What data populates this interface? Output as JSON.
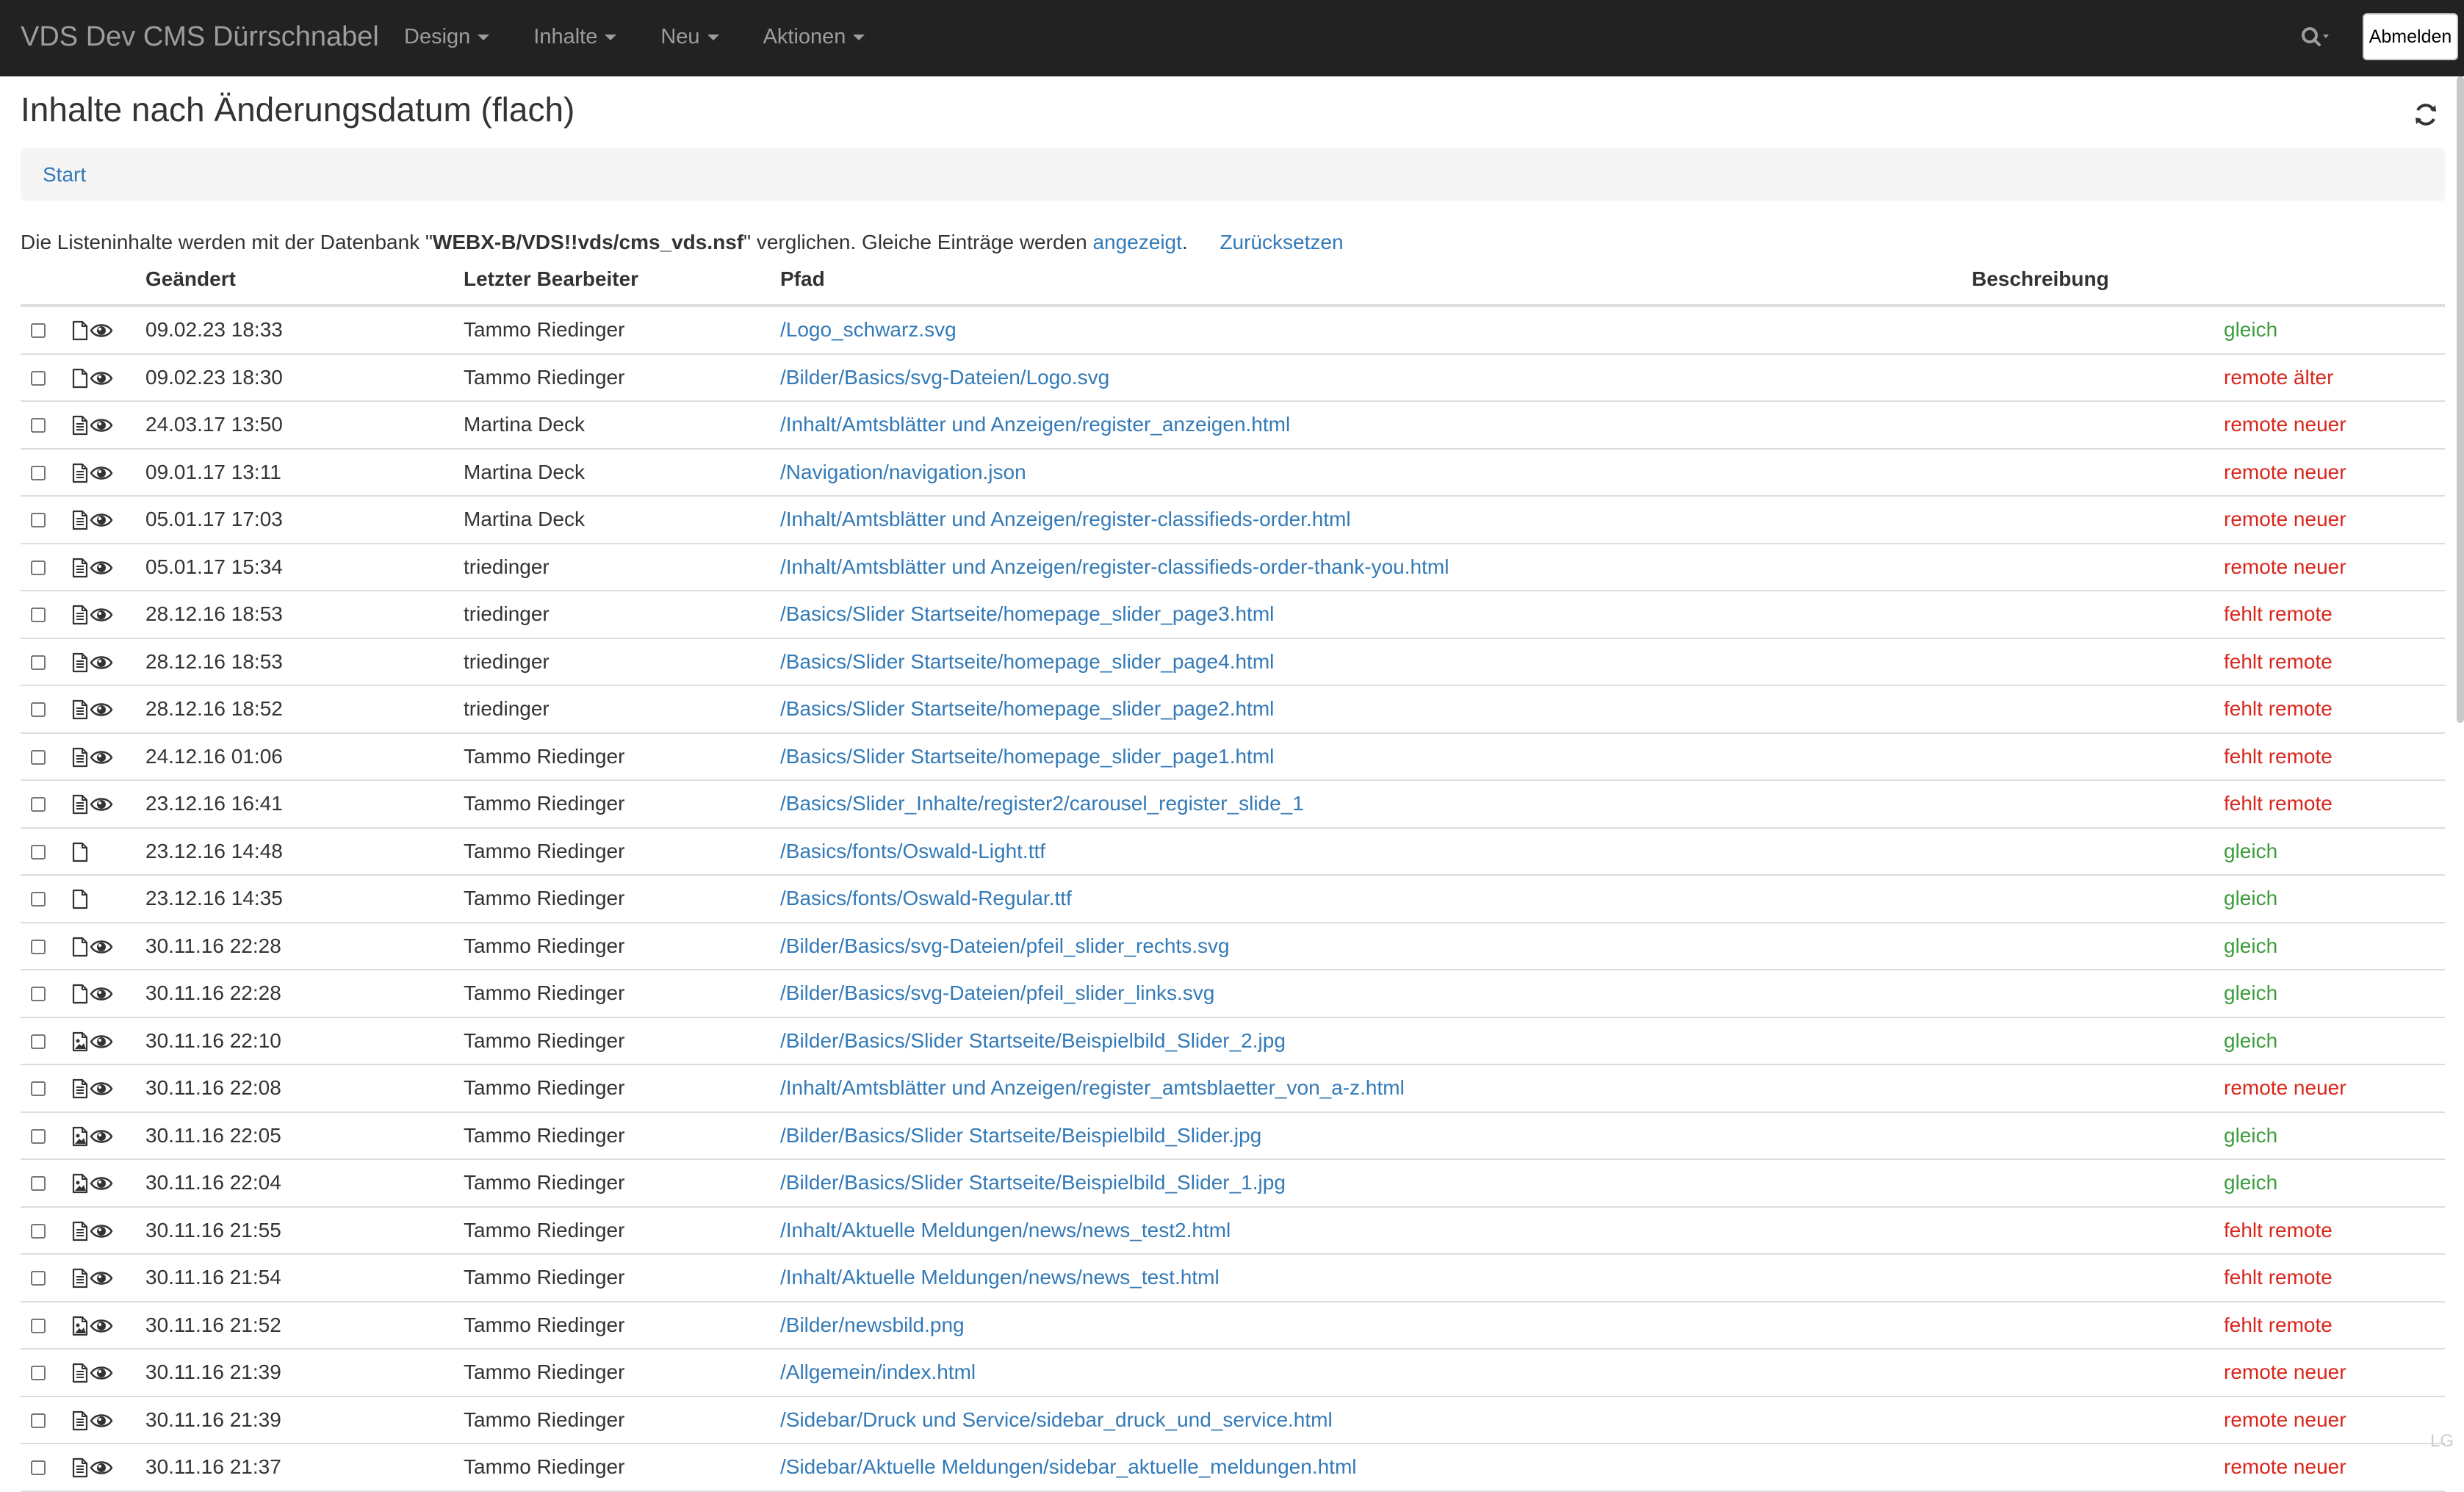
{
  "navbar": {
    "brand": "VDS Dev CMS Dürrschnabel",
    "menu": [
      "Design",
      "Inhalte",
      "Neu",
      "Aktionen"
    ],
    "logout_label": "Abmelden"
  },
  "page": {
    "title": "Inhalte nach Änderungsdatum (flach)",
    "breadcrumb": "Start"
  },
  "info": {
    "prefix": "Die Listeninhalte werden mit der Datenbank \"",
    "database": "WEBX-B/VDS!!vds/cms_vds.nsf",
    "middle": "\" verglichen. Gleiche Einträge werden ",
    "link_shown": "angezeigt",
    "dot": ".",
    "link_reset": "Zurücksetzen"
  },
  "table": {
    "headers": {
      "changed": "Geändert",
      "editor": "Letzter Bearbeiter",
      "path": "Pfad",
      "description": "Beschreibung"
    },
    "rows": [
      {
        "icon": "file",
        "preview": true,
        "date": "09.02.23 18:33",
        "editor": "Tammo Riedinger",
        "path": "/Logo_schwarz.svg",
        "status": "gleich",
        "status_type": "same"
      },
      {
        "icon": "file",
        "preview": true,
        "date": "09.02.23 18:30",
        "editor": "Tammo Riedinger",
        "path": "/Bilder/Basics/svg-Dateien/Logo.svg",
        "status": "remote älter",
        "status_type": "diff"
      },
      {
        "icon": "doc",
        "preview": true,
        "date": "24.03.17 13:50",
        "editor": "Martina Deck",
        "path": "/Inhalt/Amtsblätter und Anzeigen/register_anzeigen.html",
        "status": "remote neuer",
        "status_type": "diff"
      },
      {
        "icon": "doc",
        "preview": true,
        "date": "09.01.17 13:11",
        "editor": "Martina Deck",
        "path": "/Navigation/navigation.json",
        "status": "remote neuer",
        "status_type": "diff"
      },
      {
        "icon": "doc",
        "preview": true,
        "date": "05.01.17 17:03",
        "editor": "Martina Deck",
        "path": "/Inhalt/Amtsblätter und Anzeigen/register-classifieds-order.html",
        "status": "remote neuer",
        "status_type": "diff"
      },
      {
        "icon": "doc",
        "preview": true,
        "date": "05.01.17 15:34",
        "editor": "triedinger",
        "path": "/Inhalt/Amtsblätter und Anzeigen/register-classifieds-order-thank-you.html",
        "status": "remote neuer",
        "status_type": "diff"
      },
      {
        "icon": "doc",
        "preview": true,
        "date": "28.12.16 18:53",
        "editor": "triedinger",
        "path": "/Basics/Slider Startseite/homepage_slider_page3.html",
        "status": "fehlt remote",
        "status_type": "diff"
      },
      {
        "icon": "doc",
        "preview": true,
        "date": "28.12.16 18:53",
        "editor": "triedinger",
        "path": "/Basics/Slider Startseite/homepage_slider_page4.html",
        "status": "fehlt remote",
        "status_type": "diff"
      },
      {
        "icon": "doc",
        "preview": true,
        "date": "28.12.16 18:52",
        "editor": "triedinger",
        "path": "/Basics/Slider Startseite/homepage_slider_page2.html",
        "status": "fehlt remote",
        "status_type": "diff"
      },
      {
        "icon": "doc",
        "preview": true,
        "date": "24.12.16 01:06",
        "editor": "Tammo Riedinger",
        "path": "/Basics/Slider Startseite/homepage_slider_page1.html",
        "status": "fehlt remote",
        "status_type": "diff"
      },
      {
        "icon": "doc",
        "preview": true,
        "date": "23.12.16 16:41",
        "editor": "Tammo Riedinger",
        "path": "/Basics/Slider_Inhalte/register2/carousel_register_slide_1",
        "status": "fehlt remote",
        "status_type": "diff"
      },
      {
        "icon": "file",
        "preview": false,
        "date": "23.12.16 14:48",
        "editor": "Tammo Riedinger",
        "path": "/Basics/fonts/Oswald-Light.ttf",
        "status": "gleich",
        "status_type": "same"
      },
      {
        "icon": "file",
        "preview": false,
        "date": "23.12.16 14:35",
        "editor": "Tammo Riedinger",
        "path": "/Basics/fonts/Oswald-Regular.ttf",
        "status": "gleich",
        "status_type": "same"
      },
      {
        "icon": "file",
        "preview": true,
        "date": "30.11.16 22:28",
        "editor": "Tammo Riedinger",
        "path": "/Bilder/Basics/svg-Dateien/pfeil_slider_rechts.svg",
        "status": "gleich",
        "status_type": "same"
      },
      {
        "icon": "file",
        "preview": true,
        "date": "30.11.16 22:28",
        "editor": "Tammo Riedinger",
        "path": "/Bilder/Basics/svg-Dateien/pfeil_slider_links.svg",
        "status": "gleich",
        "status_type": "same"
      },
      {
        "icon": "image",
        "preview": true,
        "date": "30.11.16 22:10",
        "editor": "Tammo Riedinger",
        "path": "/Bilder/Basics/Slider Startseite/Beispielbild_Slider_2.jpg",
        "status": "gleich",
        "status_type": "same"
      },
      {
        "icon": "doc",
        "preview": true,
        "date": "30.11.16 22:08",
        "editor": "Tammo Riedinger",
        "path": "/Inhalt/Amtsblätter und Anzeigen/register_amtsblaetter_von_a-z.html",
        "status": "remote neuer",
        "status_type": "diff"
      },
      {
        "icon": "image",
        "preview": true,
        "date": "30.11.16 22:05",
        "editor": "Tammo Riedinger",
        "path": "/Bilder/Basics/Slider Startseite/Beispielbild_Slider.jpg",
        "status": "gleich",
        "status_type": "same"
      },
      {
        "icon": "image",
        "preview": true,
        "date": "30.11.16 22:04",
        "editor": "Tammo Riedinger",
        "path": "/Bilder/Basics/Slider Startseite/Beispielbild_Slider_1.jpg",
        "status": "gleich",
        "status_type": "same"
      },
      {
        "icon": "doc",
        "preview": true,
        "date": "30.11.16 21:55",
        "editor": "Tammo Riedinger",
        "path": "/Inhalt/Aktuelle Meldungen/news/news_test2.html",
        "status": "fehlt remote",
        "status_type": "diff"
      },
      {
        "icon": "doc",
        "preview": true,
        "date": "30.11.16 21:54",
        "editor": "Tammo Riedinger",
        "path": "/Inhalt/Aktuelle Meldungen/news/news_test.html",
        "status": "fehlt remote",
        "status_type": "diff"
      },
      {
        "icon": "image",
        "preview": true,
        "date": "30.11.16 21:52",
        "editor": "Tammo Riedinger",
        "path": "/Bilder/newsbild.png",
        "status": "fehlt remote",
        "status_type": "diff"
      },
      {
        "icon": "doc",
        "preview": true,
        "date": "30.11.16 21:39",
        "editor": "Tammo Riedinger",
        "path": "/Allgemein/index.html",
        "status": "remote neuer",
        "status_type": "diff"
      },
      {
        "icon": "doc",
        "preview": true,
        "date": "30.11.16 21:39",
        "editor": "Tammo Riedinger",
        "path": "/Sidebar/Druck und Service/sidebar_druck_und_service.html",
        "status": "remote neuer",
        "status_type": "diff"
      },
      {
        "icon": "doc",
        "preview": true,
        "date": "30.11.16 21:37",
        "editor": "Tammo Riedinger",
        "path": "/Sidebar/Aktuelle Meldungen/sidebar_aktuelle_meldungen.html",
        "status": "remote neuer",
        "status_type": "diff"
      }
    ]
  },
  "colors": {
    "same": "#3c9c3c",
    "diff": "#d9261c",
    "link": "#337ab7",
    "navbar": "#222222"
  },
  "watermark": "LG"
}
